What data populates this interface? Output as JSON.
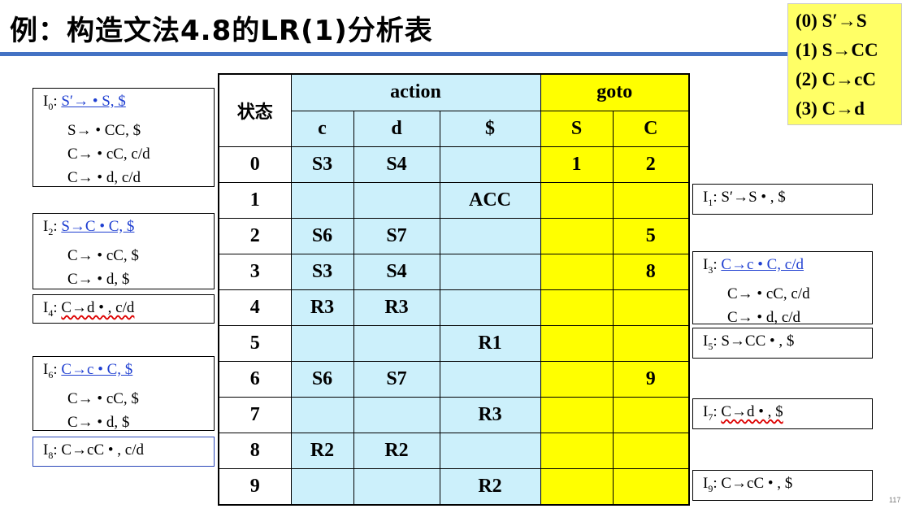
{
  "title": "例：构造文法4.8的LR(1)分析表",
  "grammar": [
    "(0) S′→S",
    "(1) S→CC",
    "(2) C→cC",
    "(3) C→d"
  ],
  "table": {
    "state_header": "状态",
    "action_header": "action",
    "goto_header": "goto",
    "action_cols": [
      "c",
      "d",
      "$"
    ],
    "goto_cols": [
      "S",
      "C"
    ],
    "rows": [
      {
        "state": "0",
        "c": "S3",
        "d": "S4",
        "end": "",
        "S": "1",
        "C": "2"
      },
      {
        "state": "1",
        "c": "",
        "d": "",
        "end": "ACC",
        "S": "",
        "C": ""
      },
      {
        "state": "2",
        "c": "S6",
        "d": "S7",
        "end": "",
        "S": "",
        "C": "5"
      },
      {
        "state": "3",
        "c": "S3",
        "d": "S4",
        "end": "",
        "S": "",
        "C": "8"
      },
      {
        "state": "4",
        "c": "R3",
        "d": "R3",
        "end": "",
        "S": "",
        "C": ""
      },
      {
        "state": "5",
        "c": "",
        "d": "",
        "end": "R1",
        "S": "",
        "C": ""
      },
      {
        "state": "6",
        "c": "S6",
        "d": "S7",
        "end": "",
        "S": "",
        "C": "9"
      },
      {
        "state": "7",
        "c": "",
        "d": "",
        "end": "R3",
        "S": "",
        "C": ""
      },
      {
        "state": "8",
        "c": "R2",
        "d": "R2",
        "end": "",
        "S": "",
        "C": ""
      },
      {
        "state": "9",
        "c": "",
        "d": "",
        "end": "R2",
        "S": "",
        "C": ""
      }
    ]
  },
  "items": {
    "I0": {
      "id": "0",
      "first": "S′→ • S,  $",
      "rest": [
        "S→ • CC,  $",
        "C→ • cC,  c/d",
        "C→ • d,   c/d"
      ]
    },
    "I1": {
      "id": "1",
      "first": "S′→S • ,  $"
    },
    "I2": {
      "id": "2",
      "first": "S→C • C,  $",
      "rest": [
        "C→ • cC,  $",
        "C→ • d,   $"
      ]
    },
    "I3": {
      "id": "3",
      "first": "C→c • C,   c/d",
      "rest": [
        "C→ • cC,   c/d",
        "C→ • d,     c/d"
      ]
    },
    "I4": {
      "id": "4",
      "first": "C→d • ,   c/d"
    },
    "I5": {
      "id": "5",
      "first": "S→CC • ,  $"
    },
    "I6": {
      "id": "6",
      "first": "C→c • C,   $",
      "rest": [
        "C→ • cC,   $",
        "C→ • d,      $"
      ]
    },
    "I7": {
      "id": "7",
      "first": "C→d • ,   $"
    },
    "I8": {
      "id": "8",
      "first": "C→cC • ,   c/d"
    },
    "I9": {
      "id": "9",
      "first": "C→cC • ,   $"
    }
  },
  "page_number": "117"
}
